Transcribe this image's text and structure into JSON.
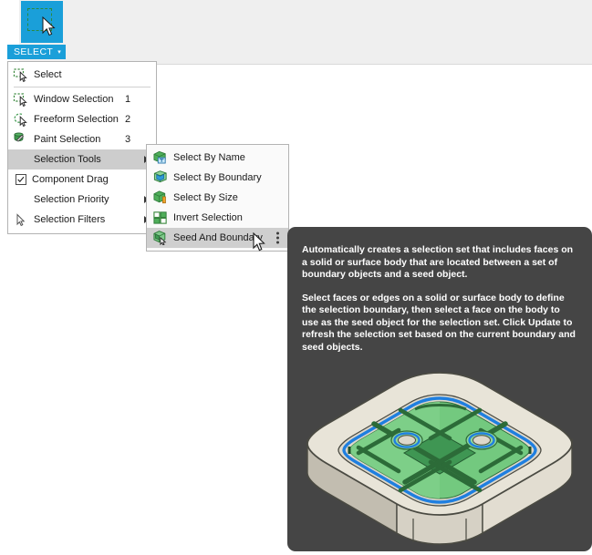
{
  "app": {
    "toolbar_icon_name": "select-tool-icon",
    "accent_color": "#1a9fd9",
    "menu_highlight_color": "#cdcdcd",
    "tooltip_background": "#454545"
  },
  "toolbar": {
    "select_tab_label": "SELECT",
    "select_tab_caret": "▾"
  },
  "menu": {
    "items": [
      {
        "label": "Select",
        "shortcut": "",
        "icon": "select-arrow-icon",
        "submenu": false,
        "checkbox": false,
        "highlighted": false
      },
      {
        "label": "Window Selection",
        "shortcut": "1",
        "icon": "window-selection-icon",
        "submenu": false,
        "checkbox": false,
        "highlighted": false
      },
      {
        "label": "Freeform Selection",
        "shortcut": "2",
        "icon": "freeform-selection-icon",
        "submenu": false,
        "checkbox": false,
        "highlighted": false
      },
      {
        "label": "Paint Selection",
        "shortcut": "3",
        "icon": "paint-selection-icon",
        "submenu": false,
        "checkbox": false,
        "highlighted": false
      },
      {
        "label": "Selection Tools",
        "shortcut": "",
        "icon": "none",
        "submenu": true,
        "checkbox": false,
        "highlighted": true
      },
      {
        "label": "Component Drag",
        "shortcut": "",
        "icon": "checkbox-checked-icon",
        "submenu": false,
        "checkbox": true,
        "highlighted": false
      },
      {
        "label": "Selection Priority",
        "shortcut": "",
        "icon": "none",
        "submenu": true,
        "checkbox": false,
        "highlighted": false
      },
      {
        "label": "Selection Filters",
        "shortcut": "",
        "icon": "filter-arrow-icon",
        "submenu": true,
        "checkbox": false,
        "highlighted": false
      }
    ]
  },
  "submenu": {
    "items": [
      {
        "label": "Select By Name",
        "icon": "select-by-name-icon",
        "highlighted": false,
        "kebab": false
      },
      {
        "label": "Select By Boundary",
        "icon": "select-by-boundary-icon",
        "highlighted": false,
        "kebab": false
      },
      {
        "label": "Select By Size",
        "icon": "select-by-size-icon",
        "highlighted": false,
        "kebab": false
      },
      {
        "label": "Invert Selection",
        "icon": "invert-selection-icon",
        "highlighted": false,
        "kebab": false
      },
      {
        "label": "Seed And Boundary",
        "icon": "seed-and-boundary-icon",
        "highlighted": true,
        "kebab": true
      }
    ]
  },
  "tooltip": {
    "paragraph_1": "Automatically creates a selection set that includes faces on a solid or surface body that are located between a set of boundary objects and a seed object.",
    "paragraph_2": "Select faces or edges on a solid or surface body to define the selection boundary, then select a face on the body to use as the seed object for the selection set. Click Update to refresh the selection set based on the current boundary and seed objects.",
    "figure_name": "seed-and-boundary-illustration"
  }
}
